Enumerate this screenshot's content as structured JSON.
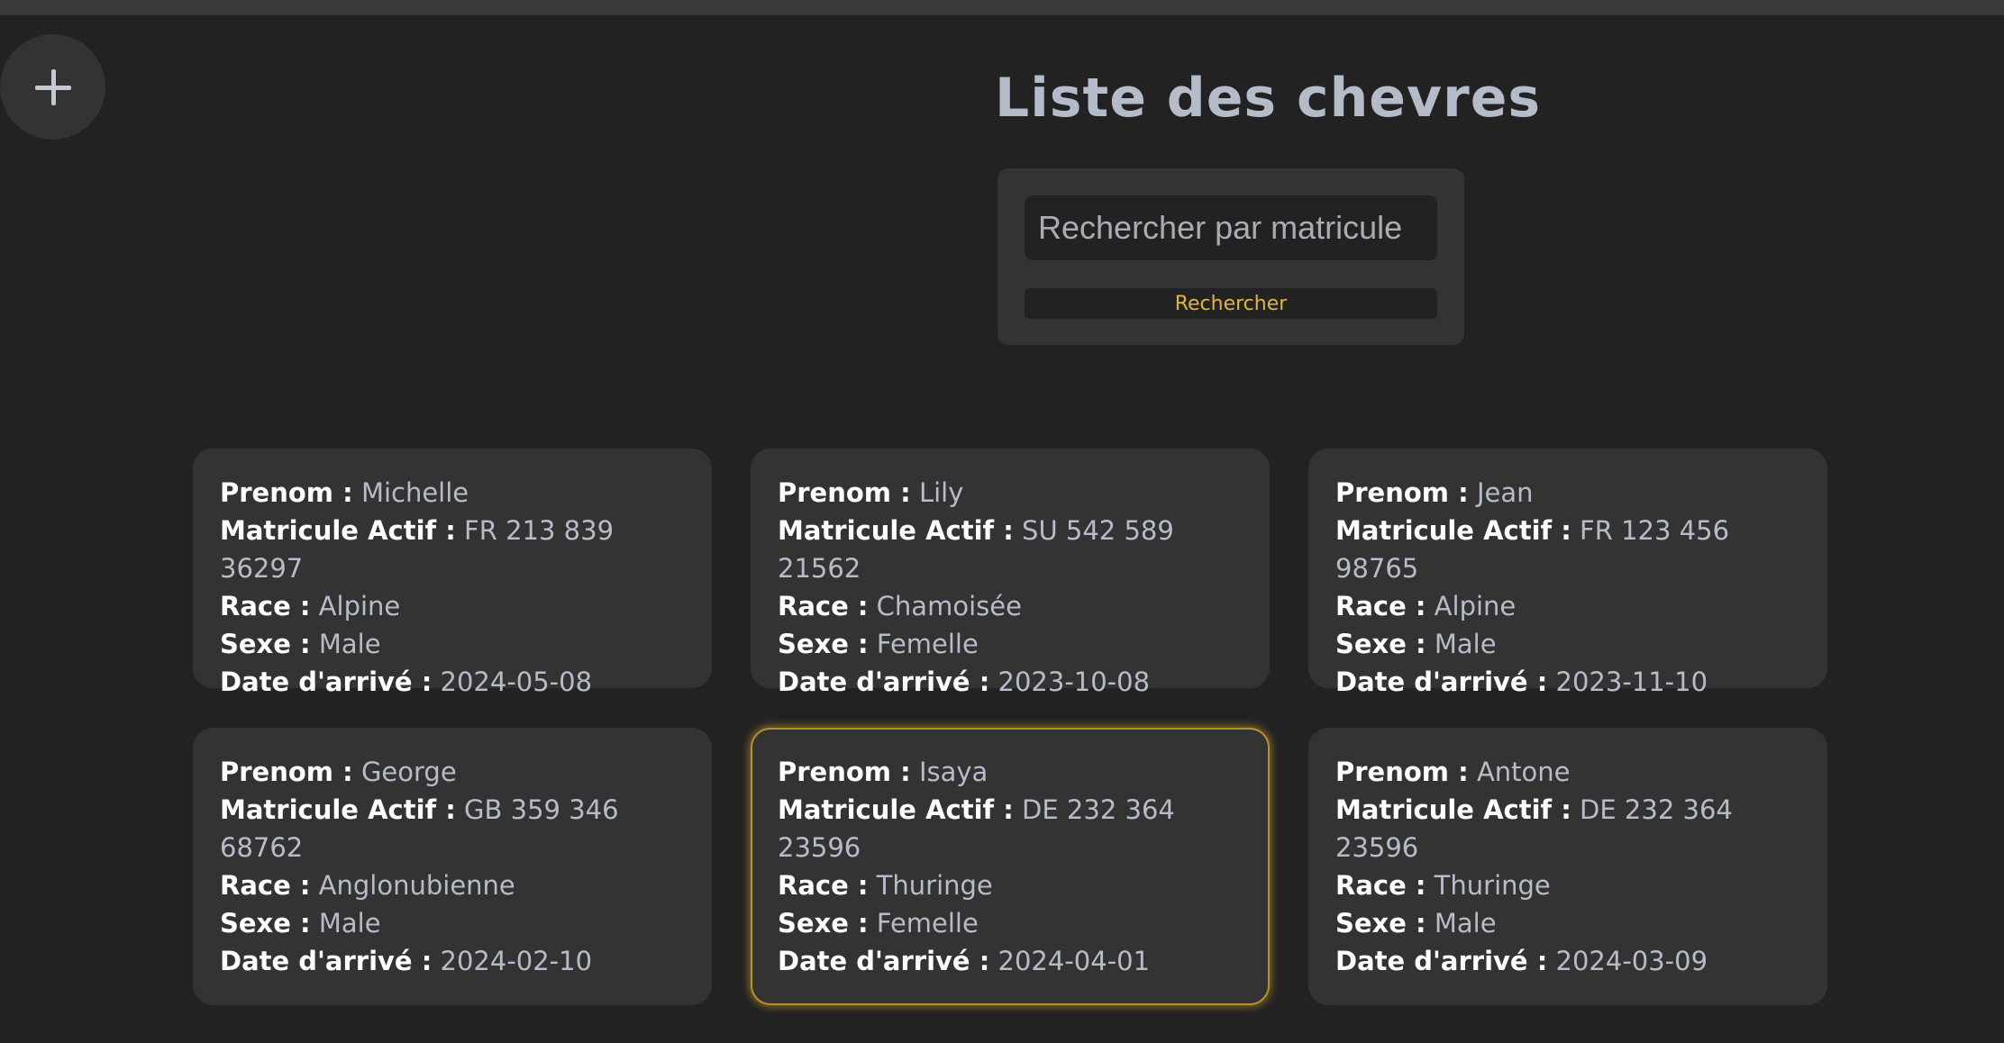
{
  "add_button_symbol": "+",
  "title": "Liste des chevres",
  "search": {
    "placeholder": "Rechercher par matricule",
    "value": "",
    "button_label": "Rechercher"
  },
  "field_labels": {
    "prenom": "Prenom :",
    "matricule": "Matricule Actif :",
    "race": "Race :",
    "sexe": "Sexe :",
    "date": "Date d'arrivé :"
  },
  "goats": [
    {
      "prenom": "Michelle",
      "matricule": "FR 213 839 36297",
      "race": "Alpine",
      "sexe": "Male",
      "date": "2024-05-08"
    },
    {
      "prenom": "Lily",
      "matricule": "SU 542 589 21562",
      "race": "Chamoisée",
      "sexe": "Femelle",
      "date": "2023-10-08"
    },
    {
      "prenom": "Jean",
      "matricule": "FR 123 456 98765",
      "race": "Alpine",
      "sexe": "Male",
      "date": "2023-11-10"
    },
    {
      "prenom": "George",
      "matricule": "GB 359 346 68762",
      "race": "Anglonubienne",
      "sexe": "Male",
      "date": "2024-02-10"
    },
    {
      "prenom": "Isaya",
      "matricule": "DE 232 364 23596",
      "race": "Thuringe",
      "sexe": "Femelle",
      "date": "2024-04-01"
    },
    {
      "prenom": "Antone",
      "matricule": "DE 232 364 23596",
      "race": "Thuringe",
      "sexe": "Male",
      "date": "2024-03-09"
    }
  ],
  "colors": {
    "background": "#222222",
    "card": "#333333",
    "accent": "#e2b43b",
    "title": "#b4bbc9"
  }
}
